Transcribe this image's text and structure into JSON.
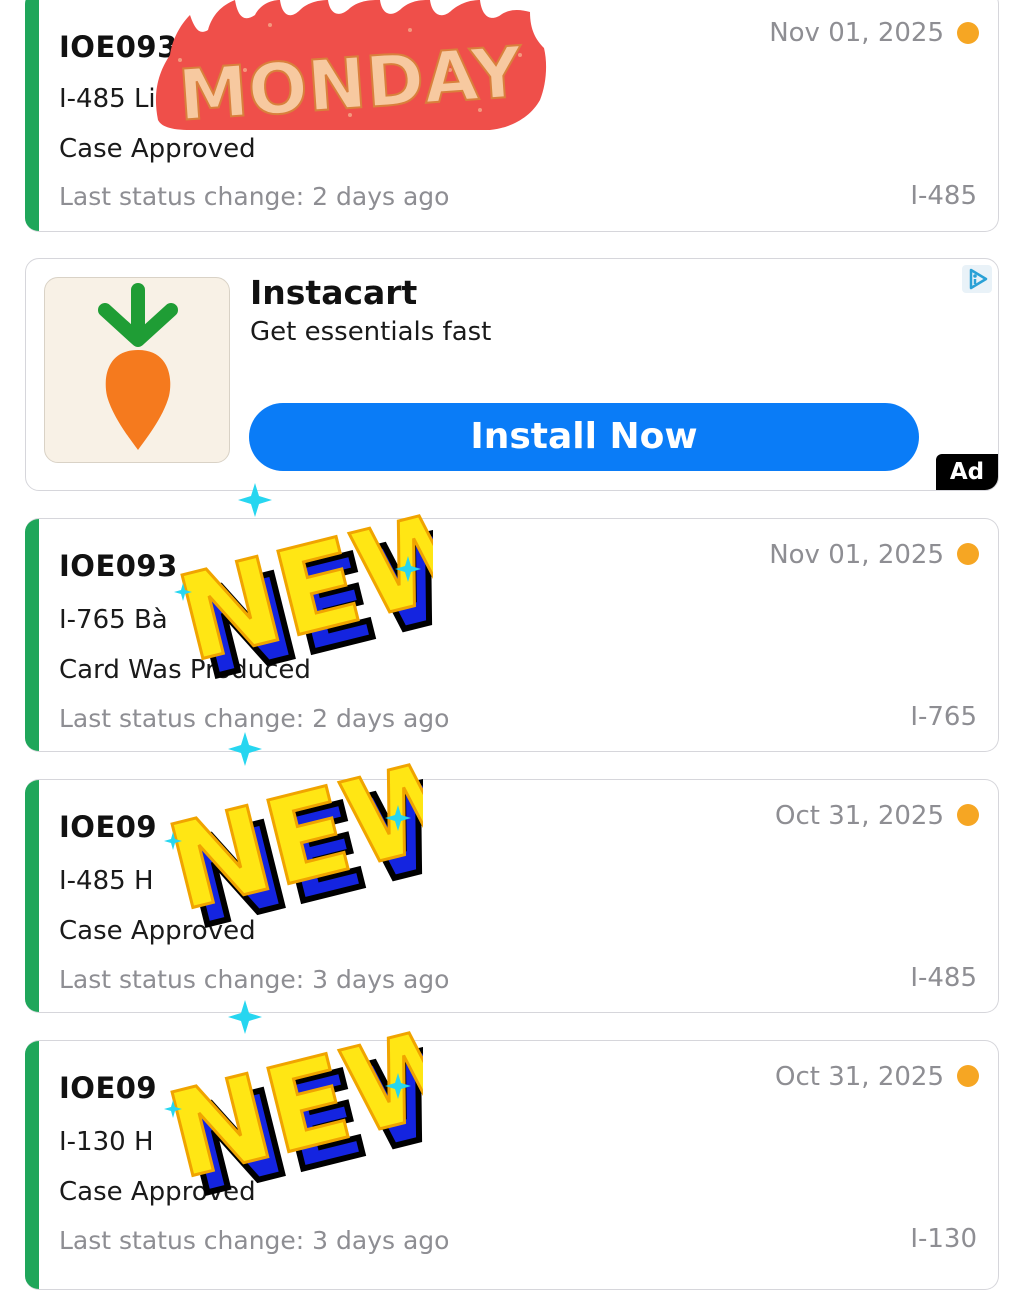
{
  "cases": [
    {
      "id": "IOE093",
      "form": "I-485 Li",
      "status": "Case Approved",
      "last_change": "Last status change: 2 days ago",
      "date": "Nov 01, 2025",
      "type": "I-485"
    },
    {
      "id": "IOE093",
      "form": "I-765 Bà",
      "status": "Card Was Produced",
      "last_change": "Last status change: 2 days ago",
      "date": "Nov 01, 2025",
      "type": "I-765"
    },
    {
      "id": "IOE09",
      "form": "I-485 H",
      "status": "Case Approved",
      "last_change": "Last status change: 3 days ago",
      "date": "Oct 31, 2025",
      "type": "I-485"
    },
    {
      "id": "IOE09",
      "form": "I-130 H",
      "status": "Case Approved",
      "last_change": "Last status change: 3 days ago",
      "date": "Oct 31, 2025",
      "type": "I-130"
    }
  ],
  "ad": {
    "title": "Instacart",
    "subtitle": "Get essentials fast",
    "button": "Install Now",
    "badge": "Ad"
  },
  "stickers": {
    "monday": "MONDAY",
    "new": "NEW"
  },
  "colors": {
    "accent": "#1fa65a",
    "status_dot": "#f6a623",
    "install_button": "#0a7cf7",
    "monday_flame": "#ef4f4a"
  }
}
